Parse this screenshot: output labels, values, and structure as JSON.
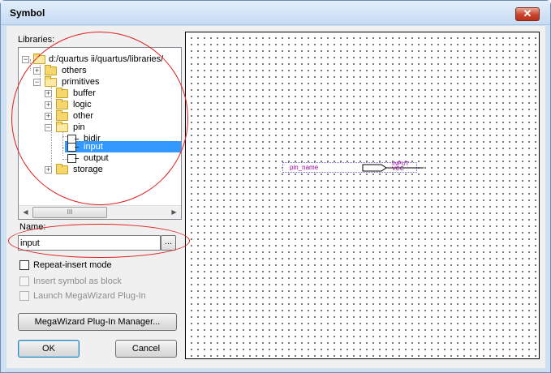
{
  "window": {
    "title": "Symbol",
    "close_glyph": "✕"
  },
  "libraries_label": "Libraries:",
  "tree": {
    "root": "d:/quartus ii/quartus/libraries/",
    "others": "others",
    "primitives": "primitives",
    "buffer": "buffer",
    "logic": "logic",
    "other": "other",
    "pin": "pin",
    "bidir": "bidir",
    "input": "input",
    "output": "output",
    "storage": "storage",
    "scroll_thumb_glyph": "III",
    "selected_item": "input"
  },
  "name_label": "Name:",
  "name_value": "input",
  "browse_label": "...",
  "options": {
    "repeat_insert": {
      "label": "Repeat-insert mode",
      "checked": false,
      "enabled": true
    },
    "insert_as_block": {
      "label": "Insert symbol as block",
      "checked": false,
      "enabled": false
    },
    "launch_megawizard": {
      "label": "Launch MegaWizard Plug-In",
      "checked": false,
      "enabled": false
    }
  },
  "buttons": {
    "megawizard": "MegaWizard Plug-In Manager...",
    "ok": "OK",
    "cancel": "Cancel"
  },
  "preview": {
    "pin_name": "pin_name",
    "io_type": "INPUT",
    "io_level": "VCC"
  },
  "colors": {
    "selection": "#3399ff",
    "annotation_circle": "#e02020",
    "pin_text": "#a000a0"
  }
}
